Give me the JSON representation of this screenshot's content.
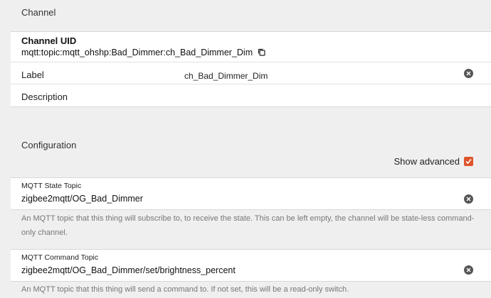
{
  "channel_section": {
    "title": "Channel",
    "uid_title": "Channel UID",
    "uid_value": "mqtt:topic:mqtt_ohshp:Bad_Dimmer:ch_Bad_Dimmer_Dim",
    "label_caption": "Label",
    "label_value": "ch_Bad_Dimmer_Dim",
    "description_caption": "Description"
  },
  "config_section": {
    "title": "Configuration",
    "show_advanced_label": "Show advanced",
    "show_advanced_checked": true,
    "fields": [
      {
        "label": "MQTT State Topic",
        "value": "zigbee2mqtt/OG_Bad_Dimmer",
        "help": "An MQTT topic that this thing will subscribe to, to receive the state. This can be left empty, the channel will be state-less command-only channel."
      },
      {
        "label": "MQTT Command Topic",
        "value": "zigbee2mqtt/OG_Bad_Dimmer/set/brightness_percent",
        "help": "An MQTT topic that this thing will send a command to. If not set, this will be a read-only switch."
      }
    ]
  },
  "colors": {
    "accent": "#e0542b",
    "background": "#efefef"
  }
}
